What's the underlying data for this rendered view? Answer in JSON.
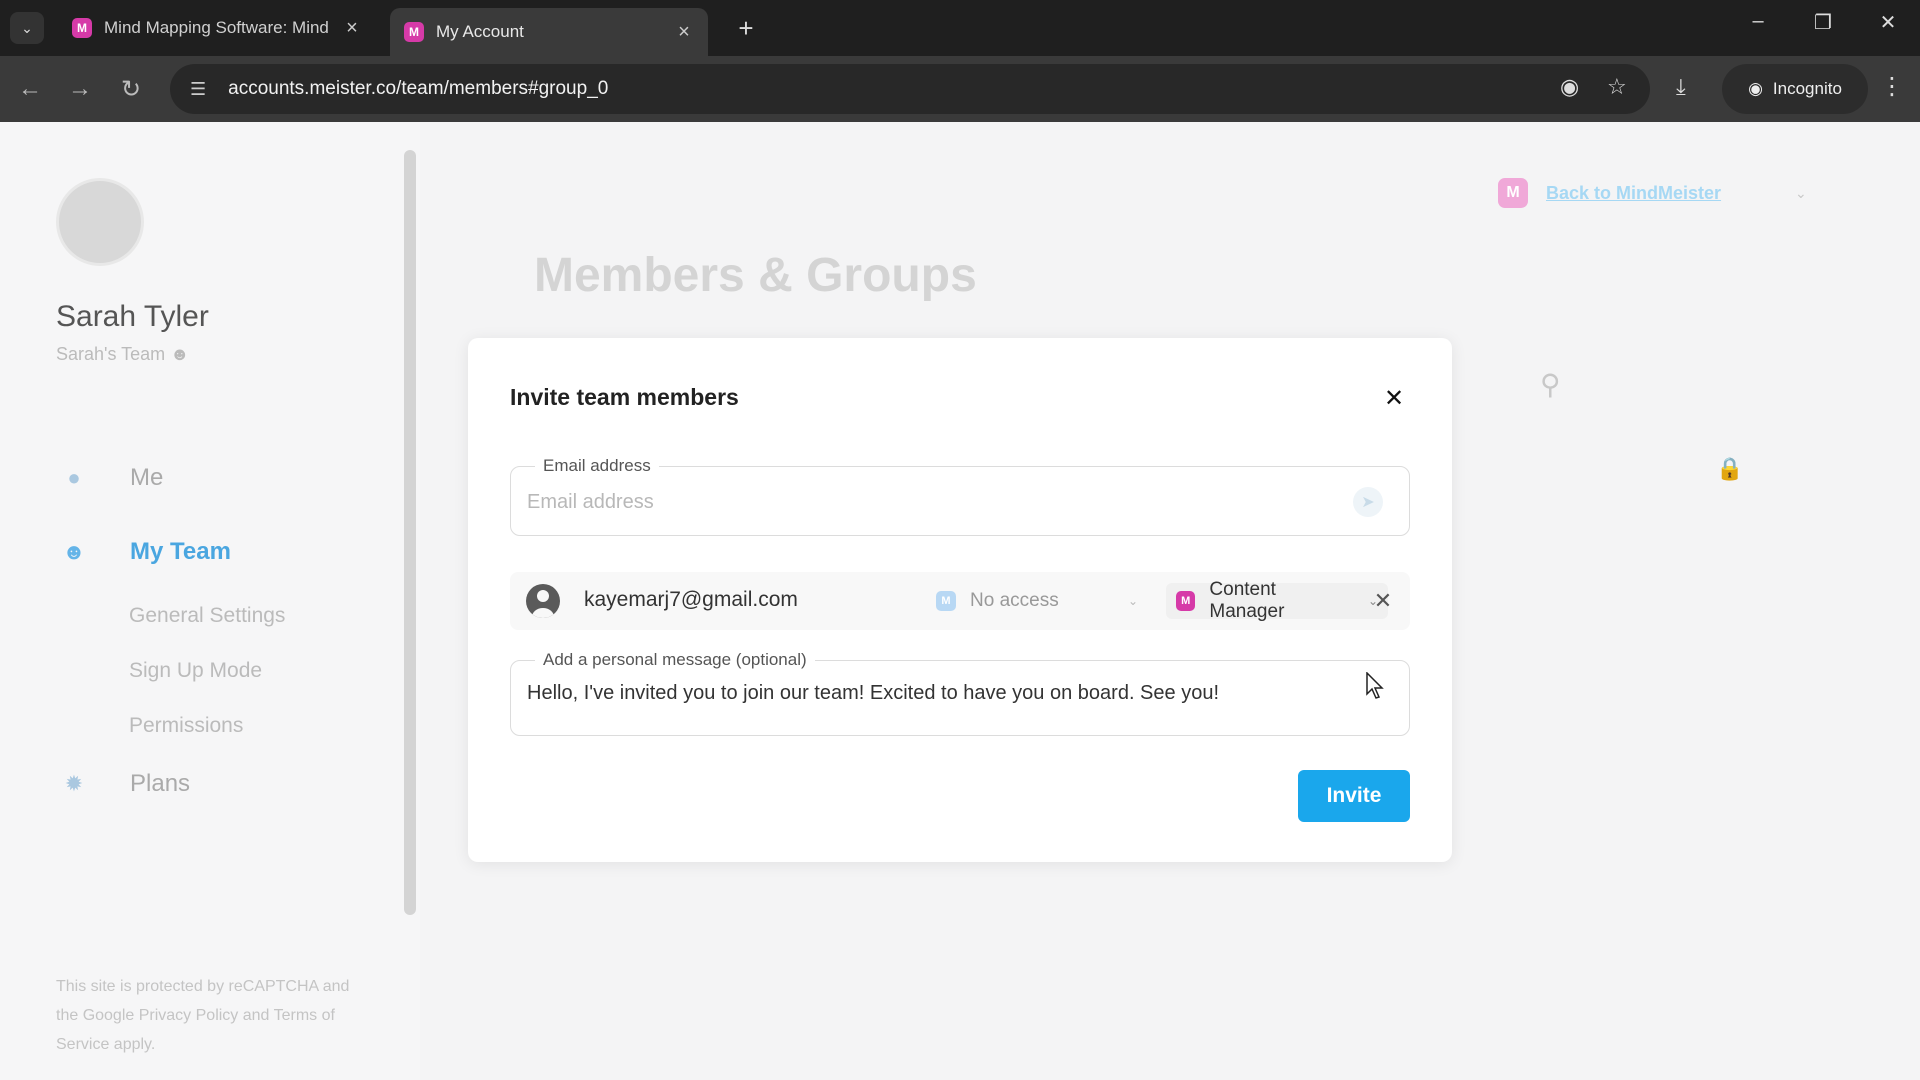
{
  "browser": {
    "tabs": [
      {
        "label": "Mind Mapping Software: Mind",
        "favicon": "M",
        "active": false
      },
      {
        "label": "My Account",
        "favicon": "M",
        "active": true
      }
    ],
    "new_tab_icon": "plus-icon",
    "url": "accounts.meister.co/team/members#group_0",
    "incognito_label": "Incognito"
  },
  "sidebar": {
    "user_name": "Sarah Tyler",
    "team_name": "Sarah's Team",
    "nav": [
      {
        "label": "Me",
        "icon": "person-icon",
        "active": false
      },
      {
        "label": "My Team",
        "icon": "team-icon",
        "active": true
      },
      {
        "label": "Plans",
        "icon": "plans-icon",
        "active": false
      }
    ],
    "sub_items": [
      "General Settings",
      "Sign Up Mode",
      "Permissions"
    ],
    "captcha_text": "This site is protected by reCAPTCHA and the Google Privacy Policy and Terms of Service apply."
  },
  "header": {
    "title": "Members & Groups",
    "back_link": "Back to MindMeister",
    "back_favicon": "M"
  },
  "modal": {
    "title": "Invite team members",
    "email_label": "Email address",
    "email_placeholder": "Email address",
    "email_value": "",
    "invitee": {
      "email": "kayemarj7@gmail.com",
      "meistertask_access": "No access",
      "mindmeister_role": "Content Manager"
    },
    "message_label": "Add a personal message (optional)",
    "message_value": "Hello, I've invited you to join our team! Excited to have you on board. See you!",
    "invite_button": "Invite"
  },
  "colors": {
    "accent": "#1aa7ec",
    "mindmeister_brand": "#d63aa8",
    "active_nav": "#4aa6e0"
  }
}
